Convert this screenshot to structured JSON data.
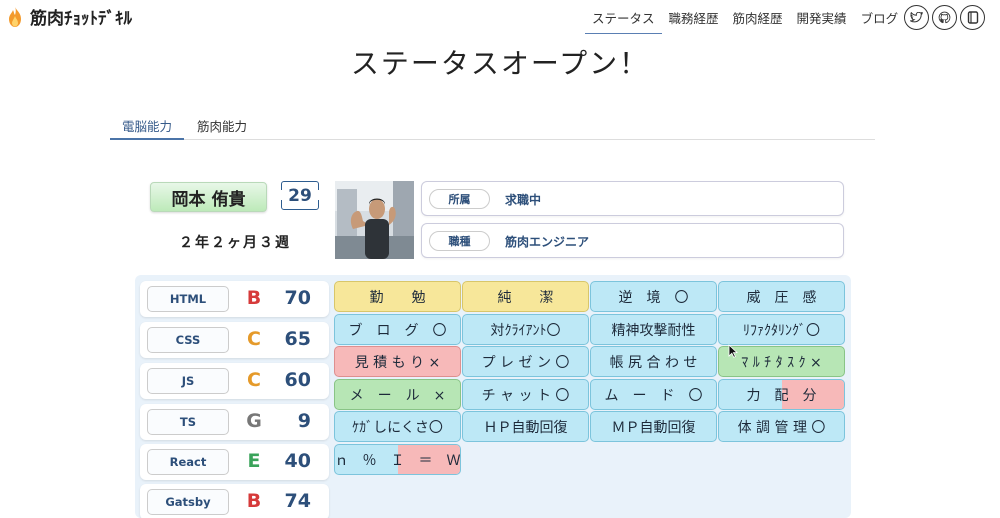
{
  "header": {
    "logo_text": "筋肉ﾁｮｯﾄﾃﾞｷﾙ",
    "nav": [
      "ステータス",
      "職務経歴",
      "筋肉経歴",
      "開発実績",
      "ブログ"
    ],
    "social_icons": [
      "twitter-icon",
      "github-icon",
      "blog-icon"
    ]
  },
  "title": "ステータスオープン！",
  "tabs": [
    "電脳能力",
    "筋肉能力"
  ],
  "profile": {
    "name": "岡本 侑貴",
    "age": "29",
    "tenure": "２年２ヶ月３週"
  },
  "info": [
    {
      "label": "所属",
      "value": "求職中"
    },
    {
      "label": "職種",
      "value": "筋肉エンジニア"
    }
  ],
  "languages": [
    {
      "name": "HTML",
      "grade": "B",
      "score": "70",
      "grade_color": "#d63a3a"
    },
    {
      "name": "CSS",
      "grade": "C",
      "score": "65",
      "grade_color": "#e59a2a"
    },
    {
      "name": "JS",
      "grade": "C",
      "score": "60",
      "grade_color": "#e59a2a"
    },
    {
      "name": "TS",
      "grade": "G",
      "score": "9",
      "grade_color": "#777777"
    },
    {
      "name": "React",
      "grade": "E",
      "score": "40",
      "grade_color": "#3aa35a"
    },
    {
      "name": "Gatsby",
      "grade": "B",
      "score": "74",
      "grade_color": "#d63a3a"
    }
  ],
  "skills": [
    [
      {
        "text": "勤　　勉",
        "color": "yellow"
      },
      {
        "text": "純　　潔",
        "color": "yellow"
      },
      {
        "text": "逆　境　〇",
        "color": "blue"
      },
      {
        "text": "威　圧　感",
        "color": "blue"
      }
    ],
    [
      {
        "text": "ブ　ロ　グ　〇",
        "color": "blue"
      },
      {
        "text": "対ｸﾗｲｱﾝﾄ〇",
        "color": "blue"
      },
      {
        "text": "精神攻撃耐性",
        "color": "blue"
      },
      {
        "text": "ﾘﾌｧｸﾀﾘﾝｸﾞ〇",
        "color": "blue"
      }
    ],
    [
      {
        "text": "見 積 も り ×",
        "color": "red"
      },
      {
        "text": "プ レ ゼ ン 〇",
        "color": "blue"
      },
      {
        "text": "帳 尻 合 わ せ",
        "color": "blue"
      },
      {
        "text": "ﾏ ﾙ ﾁ ﾀ ｽ ｸ ×",
        "color": "green"
      }
    ],
    [
      {
        "text": "メ　ー　ル　×",
        "color": "green"
      },
      {
        "text": "チ ャ ッ ト 〇",
        "color": "blue"
      },
      {
        "text": "ム　ー　ド　〇",
        "color": "blue"
      },
      {
        "text": "力　配　分",
        "color": "blue",
        "split": 0.5
      }
    ],
    [
      {
        "text": "ｹｶﾞしにくさ〇",
        "color": "blue"
      },
      {
        "text": "ＨＰ自動回復",
        "color": "blue"
      },
      {
        "text": "ＭＰ自動回復",
        "color": "blue"
      },
      {
        "text": "体 調 管 理 〇",
        "color": "blue"
      }
    ],
    [
      {
        "text": "ｎ　％　Ｉ　＝　Ｗ",
        "color": "blue",
        "split": 0.5
      }
    ]
  ]
}
